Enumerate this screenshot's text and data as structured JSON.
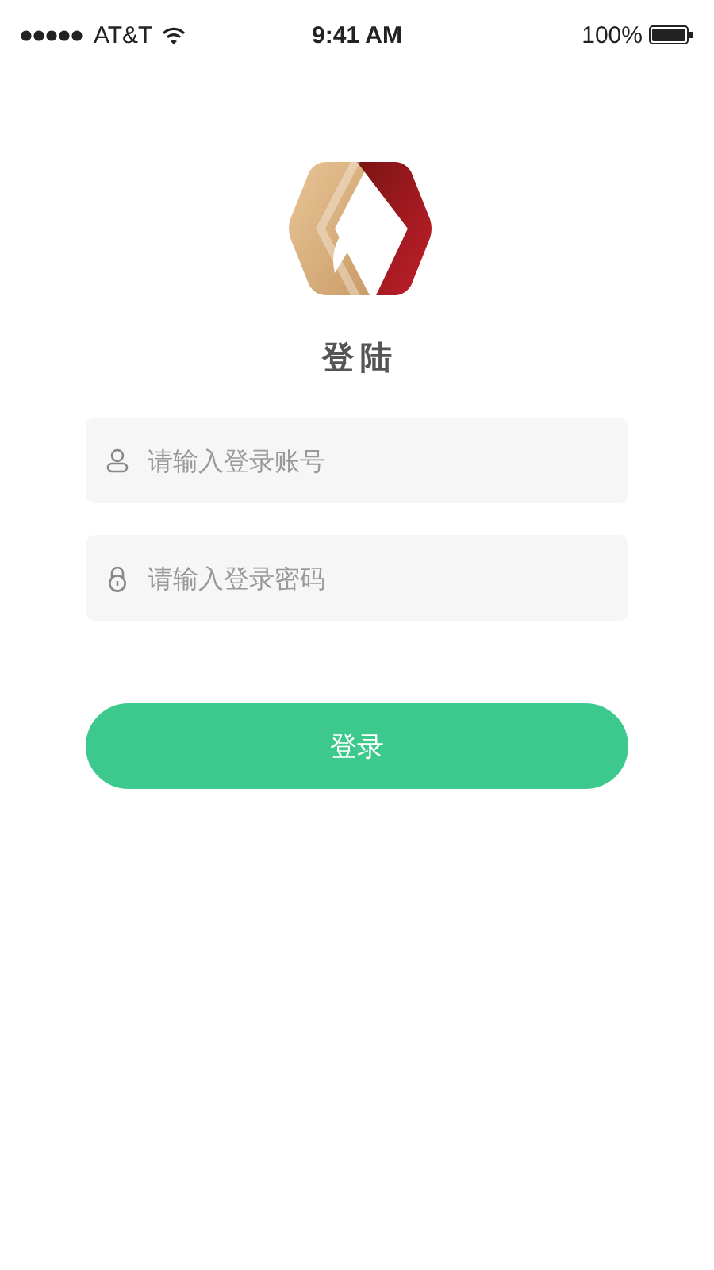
{
  "status_bar": {
    "carrier": "AT&T",
    "time": "9:41 AM",
    "battery": "100%"
  },
  "title": "登陆",
  "fields": [
    {
      "kind": "account",
      "placeholder": "请输入登录账号"
    },
    {
      "kind": "password",
      "placeholder": "请输入登录密码"
    }
  ],
  "submit": "登录"
}
